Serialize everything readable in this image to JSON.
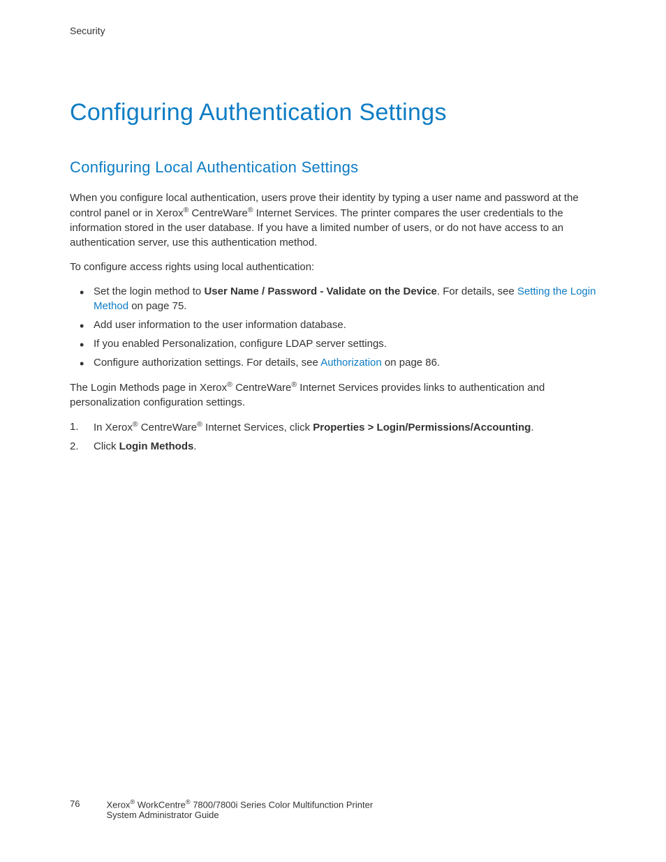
{
  "headerSection": "Security",
  "h1": "Configuring Authentication Settings",
  "h2": "Configuring Local Authentication Settings",
  "p1_part1": "When you configure local authentication, users prove their identity by typing a user name and password at the control panel or in Xerox",
  "p1_part2": " CentreWare",
  "p1_part3": " Internet Services. The printer compares the user credentials to the information stored in the user database. If you have a limited number of users, or do not have access to an authentication server, use this authentication method.",
  "p2": "To configure access rights using local authentication:",
  "bullet1_text1": "Set the login method to ",
  "bullet1_bold": "User Name / Password - Validate on the Device",
  "bullet1_text2": ". For details, see ",
  "bullet1_link": "Setting the Login Method",
  "bullet1_text3": " on page 75.",
  "bullet2": "Add user information to the user information database.",
  "bullet3": "If you enabled Personalization, configure LDAP server settings.",
  "bullet4_text1": "Configure authorization settings. For details, see ",
  "bullet4_link": "Authorization",
  "bullet4_text2": " on page 86.",
  "p3_part1": "The Login Methods page in Xerox",
  "p3_part2": " CentreWare",
  "p3_part3": " Internet Services provides links to authentication and personalization configuration settings.",
  "ol1_num": "1.",
  "ol1_text1": "In Xerox",
  "ol1_text2": " CentreWare",
  "ol1_text3": " Internet Services, click ",
  "ol1_bold": "Properties > Login/Permissions/Accounting",
  "ol1_text4": ".",
  "ol2_num": "2.",
  "ol2_text1": "Click ",
  "ol2_bold": "Login Methods",
  "ol2_text2": ".",
  "pageNum": "76",
  "footer_line1_part1": "Xerox",
  "footer_line1_part2": " WorkCentre",
  "footer_line1_part3": " 7800/7800i Series Color Multifunction Printer",
  "footer_line2": "System Administrator Guide",
  "reg": "®"
}
